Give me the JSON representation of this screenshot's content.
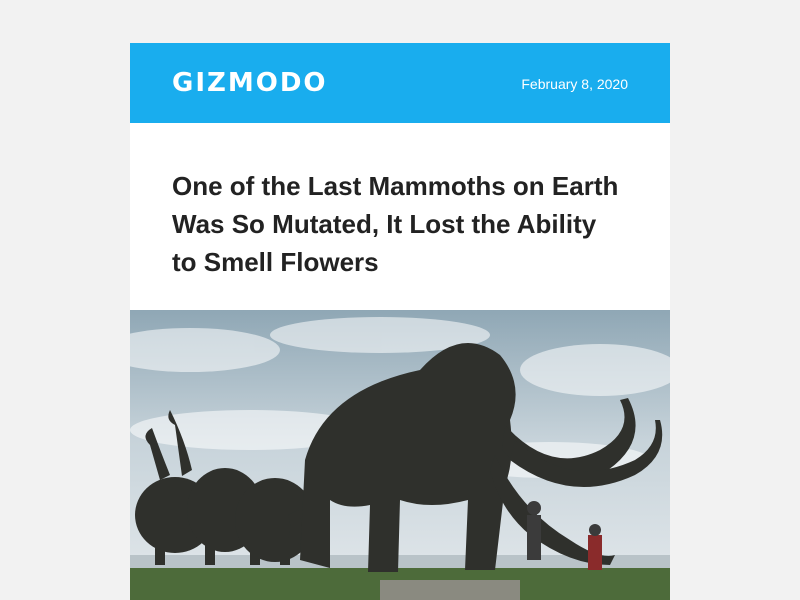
{
  "brand": {
    "name": "GIZMODO",
    "color": "#19adee"
  },
  "header": {
    "date": "February 8, 2020"
  },
  "article": {
    "headline": "One of the Last Mammoths on Earth Was So Mutated, It Lost the Ability to Smell Flowers",
    "hero_image": {
      "icon": "mammoth-statues-photo"
    }
  }
}
